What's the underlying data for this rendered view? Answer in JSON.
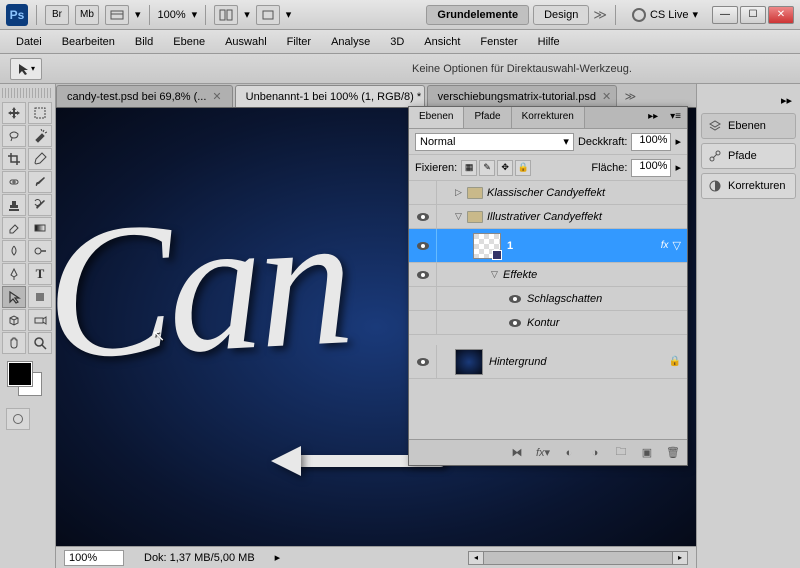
{
  "app": {
    "ps_label": "Ps"
  },
  "title_bar": {
    "br": "Br",
    "mb": "Mb",
    "zoom": "100%",
    "workspace_active": "Grundelemente",
    "workspace_other": "Design",
    "cs_live": "CS Live"
  },
  "menu": [
    "Datei",
    "Bearbeiten",
    "Bild",
    "Ebene",
    "Auswahl",
    "Filter",
    "Analyse",
    "3D",
    "Ansicht",
    "Fenster",
    "Hilfe"
  ],
  "options_bar": {
    "text": "Keine Optionen für Direktauswahl-Werkzeug."
  },
  "doc_tabs": [
    {
      "label": "candy-test.psd bei 69,8% (...",
      "active": false
    },
    {
      "label": "Unbenannt-1 bei 100% (1, RGB/8) *",
      "active": true
    },
    {
      "label": "verschiebungsmatrix-tutorial.psd",
      "active": false
    }
  ],
  "canvas": {
    "text": "Can"
  },
  "status": {
    "zoom": "100%",
    "doc_info": "Dok: 1,37 MB/5,00 MB"
  },
  "right_dock": [
    {
      "label": "Ebenen",
      "active": true
    },
    {
      "label": "Pfade",
      "active": false
    },
    {
      "label": "Korrekturen",
      "active": false
    }
  ],
  "layers_panel": {
    "tabs": [
      "Ebenen",
      "Pfade",
      "Korrekturen"
    ],
    "blend_mode": "Normal",
    "opacity_label": "Deckkraft:",
    "opacity_value": "100%",
    "lock_label": "Fixieren:",
    "fill_label": "Fläche:",
    "fill_value": "100%",
    "groups": {
      "g1": "Klassischer Candyeffekt",
      "g2": "Illustrativer Candyeffekt"
    },
    "selected_layer": "1",
    "fx_label": "fx",
    "effects_label": "Effekte",
    "effects": [
      "Schlagschatten",
      "Kontur"
    ],
    "background": "Hintergrund"
  }
}
